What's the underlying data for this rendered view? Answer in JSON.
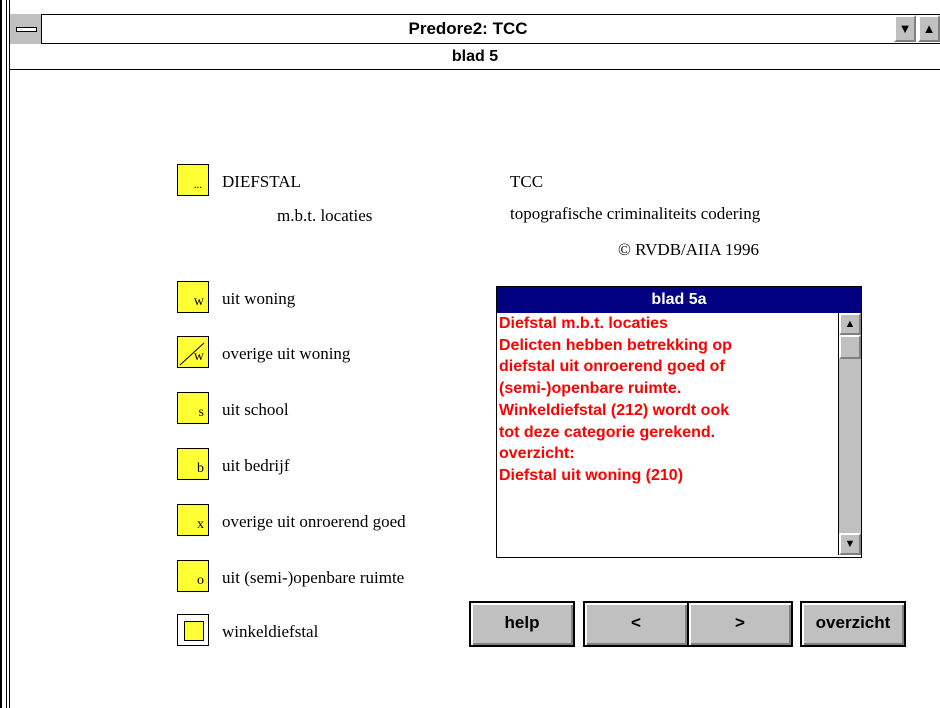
{
  "window": {
    "title": "Predore2: TCC",
    "subtitle": "blad 5",
    "minimize_glyph": "▼",
    "maximize_glyph": "▲"
  },
  "heading": {
    "box_glyph": "...",
    "title": "DIEFSTAL",
    "subtitle": "m.b.t. locaties"
  },
  "info": {
    "title": "TCC",
    "subtitle": "topografische criminaliteits codering",
    "copyright": "© RVDB/AIIA 1996"
  },
  "categories": [
    {
      "code": "w",
      "label": "uit woning",
      "icon": "letter-w-icon"
    },
    {
      "code": "w",
      "label": "overige uit woning",
      "icon": "crossed-w-icon"
    },
    {
      "code": "s",
      "label": "uit school",
      "icon": "letter-s-icon"
    },
    {
      "code": "b",
      "label": "uit bedrijf",
      "icon": "letter-b-icon"
    },
    {
      "code": "x",
      "label": "overige uit onroerend goed",
      "icon": "letter-x-icon"
    },
    {
      "code": "o",
      "label": "uit (semi-)openbare ruimte",
      "icon": "letter-o-icon"
    },
    {
      "code": "",
      "label": "winkeldiefstal",
      "icon": "inner-square-icon"
    }
  ],
  "popup": {
    "title": "blad 5a",
    "lines": [
      "Diefstal m.b.t. locaties",
      "",
      "Delicten hebben betrekking op",
      "diefstal uit onroerend goed of",
      "(semi-)openbare ruimte.",
      "Winkeldiefstal (212) wordt ook",
      "tot deze categorie gerekend.",
      "",
      "overzicht:",
      "",
      "Diefstal uit woning (210)"
    ],
    "scroll_up_glyph": "▲",
    "scroll_down_glyph": "▼"
  },
  "buttons": {
    "help": "help",
    "prev": "<",
    "next": ">",
    "overview": "overzicht"
  },
  "colors": {
    "legend_box": "#ffff33",
    "popup_header": "#000080",
    "popup_text": "#ff0000",
    "button_face": "#c0c0c0"
  }
}
